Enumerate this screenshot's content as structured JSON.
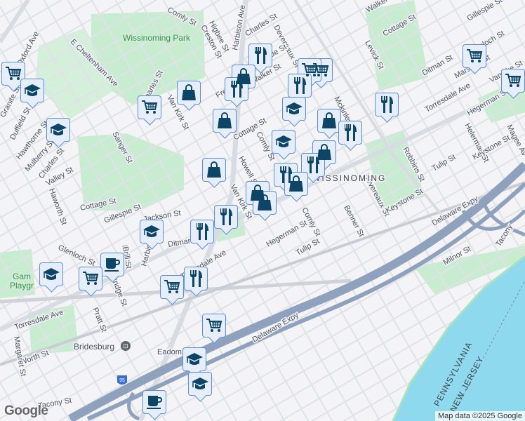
{
  "map": {
    "parks": [
      "Wissinoming Park",
      "Gam",
      "Playgr"
    ],
    "neighborhood": "WISSINOMING",
    "transit_station": "Bridesburg",
    "highway_shield": "95",
    "states": [
      "PENNSYLVANIA",
      "NEW JERSEY"
    ],
    "streets": [
      "Comly St",
      "Higbee St",
      "Creston St",
      "Charles St",
      "Devereaux St",
      "Cottage St",
      "Walker St",
      "Gillespie St",
      "Glenloch St",
      "Levick St",
      "Ditman St",
      "Marsden St",
      "Vandike St",
      "Torresdale Ave",
      "Hegerman St",
      "Helerman St",
      "Magee Av",
      "Keystone St",
      "Tulip St",
      "Robbins St",
      "Devereaux St",
      "Keystone St",
      "Benner St",
      "Comly St",
      "Hegerman St",
      "Tulip St",
      "Milnor St",
      "Delaware Expy",
      "Tacony",
      "Delaware Expy",
      "Eadom St",
      "Worth St",
      "Margaret St",
      "Tacony St",
      "Torresdale Ave",
      "Pratt St",
      "Bridge St",
      "Brill St",
      "Harbison Ave",
      "Glenloch St",
      "Gillespie St",
      "Cottage St",
      "Jackson St",
      "Ditman St",
      "Torresdale Ave",
      "Haworth St",
      "Valley St",
      "Charles St",
      "Mulberry St",
      "Hawthorne St",
      "Duffield St",
      "Granite St",
      "Sanger St",
      "Van Kirk St",
      "Charles St",
      "E Cheltenham Ave",
      "Oxford Ave",
      "Van Kirk St",
      "Howell St",
      "Cottage St",
      "Comly St",
      "Walker St",
      "Montague St",
      "Frederick St",
      "Mckinley St",
      "Harbison Ave",
      "Brill St"
    ],
    "markers": [
      "cart-icon",
      "graduation-cap-icon",
      "graduation-cap-icon",
      "cart-icon",
      "shopping-bag-icon",
      "cart-icon",
      "cart-icon",
      "restaurant-icon",
      "shopping-bag-icon",
      "restaurant-icon",
      "cart-icon",
      "cart-icon",
      "restaurant-icon",
      "graduation-cap-icon",
      "shopping-bag-icon",
      "restaurant-icon",
      "restaurant-icon",
      "shopping-bag-icon",
      "shopping-bag-icon",
      "graduation-cap-icon",
      "shopping-bag-icon",
      "restaurant-icon",
      "restaurant-icon",
      "shopping-bag-icon",
      "shopping-bag-icon",
      "shopping-bag-icon",
      "restaurant-icon",
      "restaurant-icon",
      "graduation-cap-icon",
      "coffee-icon",
      "cart-icon",
      "graduation-cap-icon",
      "restaurant-icon",
      "cart-icon",
      "cart-icon",
      "graduation-cap-icon",
      "graduation-cap-icon",
      "coffee-icon"
    ],
    "colors": {
      "water": "#8fd9ee",
      "park": "#c7ecd0",
      "expressway": "#8ea1bd",
      "land": "#f4f3f5",
      "marker_fill": "#e6edfb",
      "marker_border": "#5b8ee0",
      "icon": "#0c4566"
    }
  },
  "attribution": "Map data ©2025 Google",
  "logo": "Google"
}
